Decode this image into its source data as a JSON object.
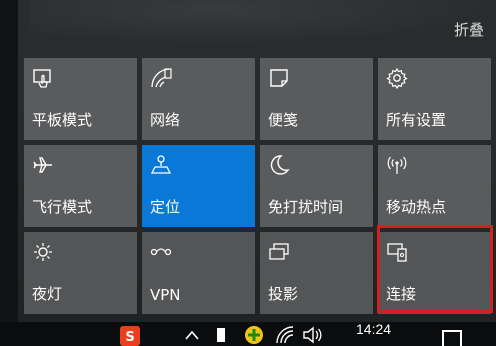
{
  "action_center": {
    "collapse_label": "折叠",
    "tiles": [
      {
        "label": "平板模式",
        "icon": "tablet-mode-icon",
        "state": "off"
      },
      {
        "label": "网络",
        "icon": "network-icon",
        "state": "off"
      },
      {
        "label": "便笺",
        "icon": "note-icon",
        "state": "off"
      },
      {
        "label": "所有设置",
        "icon": "settings-icon",
        "state": "off"
      },
      {
        "label": "飞行模式",
        "icon": "airplane-icon",
        "state": "off"
      },
      {
        "label": "定位",
        "icon": "location-icon",
        "state": "on"
      },
      {
        "label": "免打扰时间",
        "icon": "moon-icon",
        "state": "off"
      },
      {
        "label": "移动热点",
        "icon": "hotspot-icon",
        "state": "off"
      },
      {
        "label": "夜灯",
        "icon": "night-light-icon",
        "state": "off"
      },
      {
        "label": "VPN",
        "icon": "vpn-icon",
        "state": "off"
      },
      {
        "label": "投影",
        "icon": "project-icon",
        "state": "off"
      },
      {
        "label": "连接",
        "icon": "connect-icon",
        "state": "off",
        "highlighted": true
      }
    ],
    "colors": {
      "tile": "#5a5b5c",
      "tile_active": "#0a78d7",
      "highlight_border": "#d12020"
    }
  },
  "taskbar": {
    "time": "14:24",
    "tray_icons": [
      "sogou-input-icon",
      "chevron-up-icon",
      "usb-icon",
      "plus-circle-icon",
      "wifi-icon",
      "volume-icon"
    ],
    "action_center_icon": "notification-icon"
  }
}
